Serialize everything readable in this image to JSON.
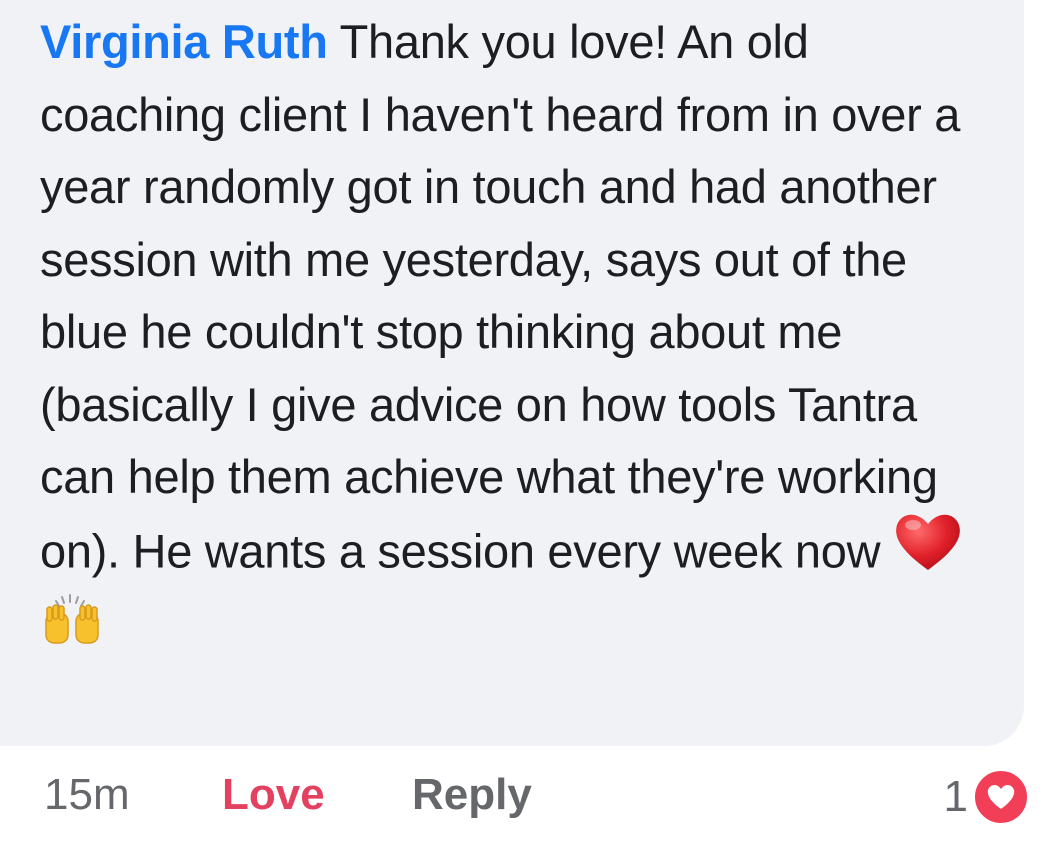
{
  "comment": {
    "author": "Virginia Ruth",
    "body": " Thank you love! An old coaching client I haven't heard from in over a year randomly got in touch and had another session with me yesterday, says out of the blue he couldn't stop thinking about me (basically I give advice on how tools Tantra can help them achieve what they're working on). He wants a session every week now ",
    "emojis": [
      "red-heart-icon",
      "raising-hands-icon"
    ]
  },
  "actions": {
    "time": "15m",
    "love_label": "Love",
    "reply_label": "Reply",
    "reaction_count": "1",
    "reaction_icon": "love-reaction-icon"
  },
  "colors": {
    "author": "#1877f2",
    "love": "#e4405f",
    "muted": "#65676b",
    "bubble": "#f0f2f5"
  }
}
